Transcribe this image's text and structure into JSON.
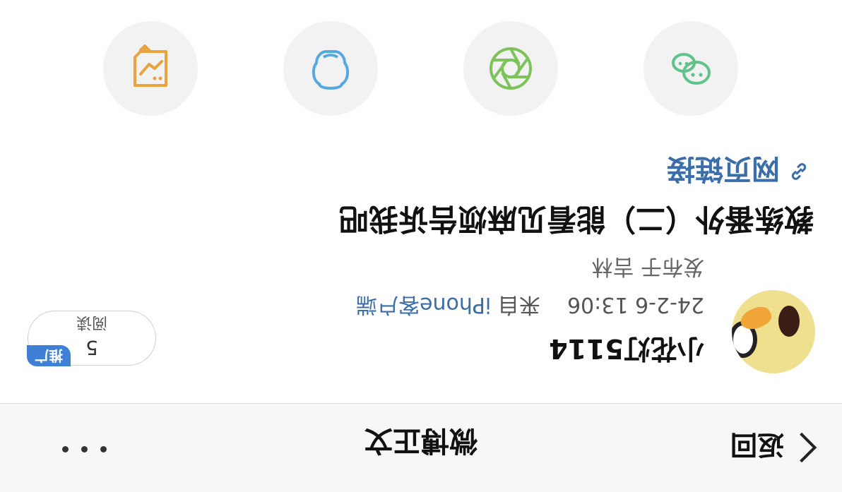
{
  "nav": {
    "back_label": "返回",
    "title": "微博正文"
  },
  "post": {
    "author": "小花灯5114",
    "datetime": "24-2-6 13:06",
    "source_prefix": "来自",
    "source": "iPhone客户端",
    "location": "发布于 吉林",
    "title": "教练番外（二）能看见麻烦告诉我吧",
    "web_link_label": "网页链接"
  },
  "reads": {
    "count": "5",
    "label": "阅读",
    "promote_label": "推广"
  },
  "share": {
    "items": [
      {
        "icon": "wechat-icon",
        "color": "#5fc38b"
      },
      {
        "icon": "moments-icon",
        "color": "#7cc35a"
      },
      {
        "icon": "qq-icon",
        "color": "#55a9e0"
      },
      {
        "icon": "qzone-chart-icon",
        "color": "#e8a33c"
      }
    ]
  }
}
